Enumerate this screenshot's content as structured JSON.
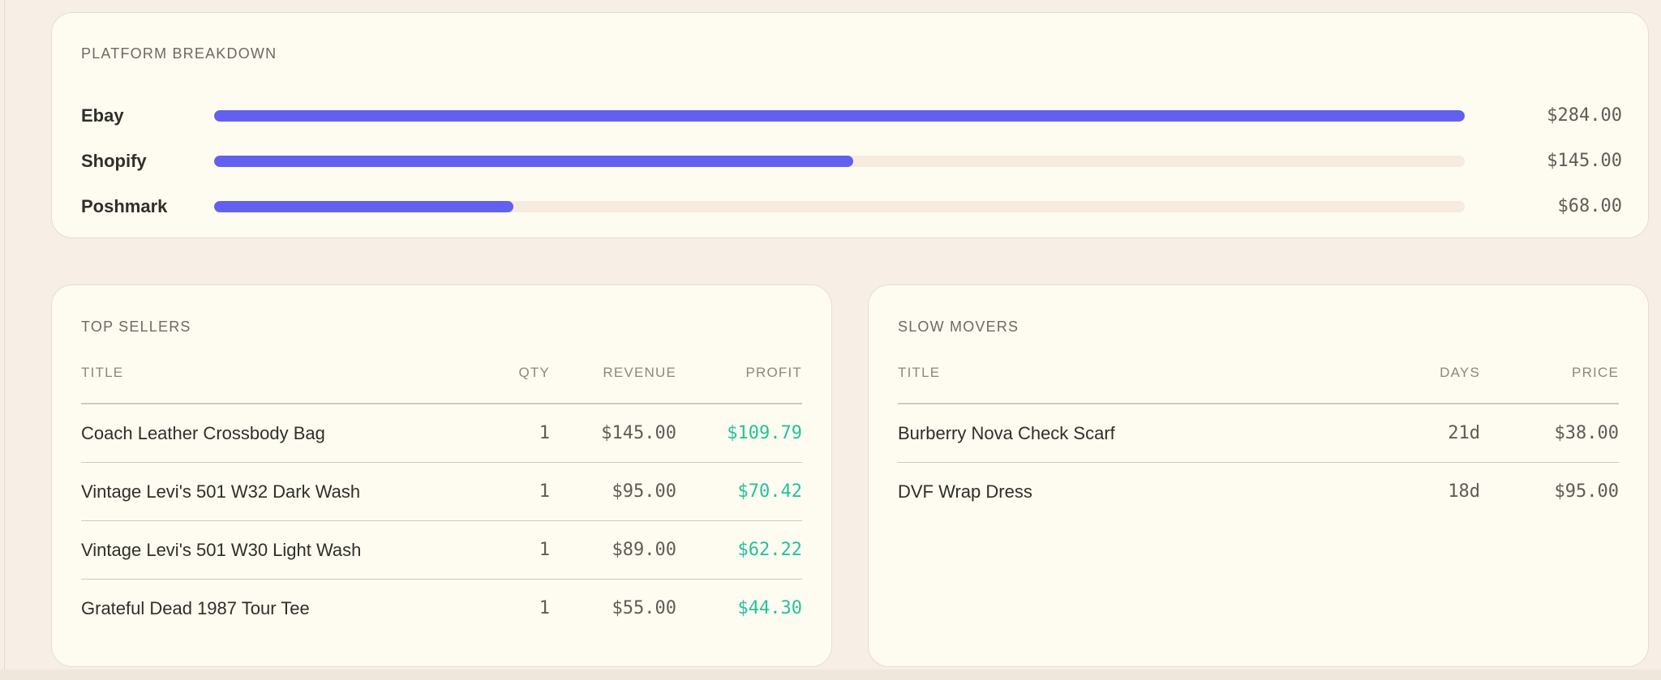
{
  "platform_breakdown": {
    "title": "PLATFORM BREAKDOWN",
    "accent_color": "#6260ee",
    "rows": [
      {
        "name": "Ebay",
        "amount": "$284.00",
        "fill_fraction": 1.0
      },
      {
        "name": "Shopify",
        "amount": "$145.00",
        "fill_fraction": 0.511
      },
      {
        "name": "Poshmark",
        "amount": "$68.00",
        "fill_fraction": 0.239
      }
    ]
  },
  "top_sellers": {
    "title": "TOP SELLERS",
    "columns": {
      "title": "TITLE",
      "qty": "QTY",
      "revenue": "REVENUE",
      "profit": "PROFIT"
    },
    "profit_color": "#25c29a",
    "rows": [
      {
        "title": "Coach Leather Crossbody Bag",
        "qty": "1",
        "revenue": "$145.00",
        "profit": "$109.79"
      },
      {
        "title": "Vintage Levi's 501 W32 Dark Wash",
        "qty": "1",
        "revenue": "$95.00",
        "profit": "$70.42"
      },
      {
        "title": "Vintage Levi's 501 W30 Light Wash",
        "qty": "1",
        "revenue": "$89.00",
        "profit": "$62.22"
      },
      {
        "title": "Grateful Dead 1987 Tour Tee",
        "qty": "1",
        "revenue": "$55.00",
        "profit": "$44.30"
      }
    ]
  },
  "slow_movers": {
    "title": "SLOW MOVERS",
    "columns": {
      "title": "TITLE",
      "days": "DAYS",
      "price": "PRICE"
    },
    "rows": [
      {
        "title": "Burberry Nova Check Scarf",
        "days": "21d",
        "price": "$38.00"
      },
      {
        "title": "DVF Wrap Dress",
        "days": "18d",
        "price": "$95.00"
      }
    ]
  }
}
